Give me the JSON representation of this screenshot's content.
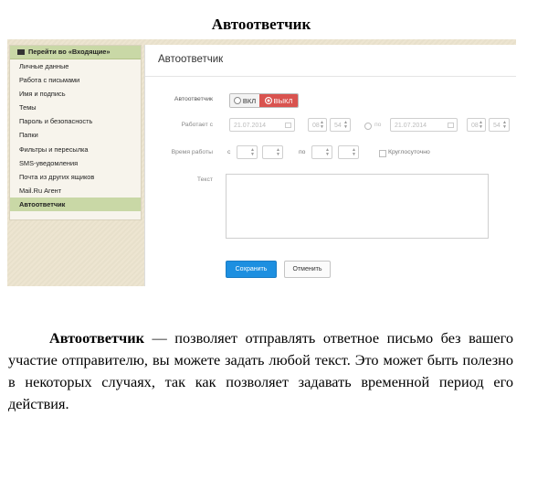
{
  "document": {
    "title": "Автоответчик",
    "paragraph": {
      "term": "Автоответчик",
      "text": " — позволяет отправлять ответное письмо без вашего участие отправителю, вы можете задать любой текст. Это может быть полезно в некоторых случаях, так как позволяет задавать временной период его действия."
    }
  },
  "screenshot": {
    "sidebar": {
      "header": "Перейти во «Входящие»",
      "items": [
        {
          "label": "Личные данные",
          "active": false
        },
        {
          "label": "Работа с письмами",
          "active": false
        },
        {
          "label": "Имя и подпись",
          "active": false
        },
        {
          "label": "Темы",
          "active": false
        },
        {
          "label": "Пароль и безопасность",
          "active": false
        },
        {
          "label": "Папки",
          "active": false
        },
        {
          "label": "Фильтры и пересылка",
          "active": false
        },
        {
          "label": "SMS-уведомления",
          "active": false
        },
        {
          "label": "Почта из других ящиков",
          "active": false
        },
        {
          "label": "Mail.Ru Агент",
          "active": false
        },
        {
          "label": "Автоответчик",
          "active": true
        }
      ]
    },
    "panel": {
      "title": "Автоответчик",
      "autoreply_label": "Автоответчик",
      "toggle_on": "ВКЛ",
      "toggle_off": "ВЫКЛ",
      "works_from_label": "Работает с",
      "date_from": "21.07.2014",
      "hour_from": "08",
      "minute_from": "54",
      "to_label": "по",
      "date_to": "21.07.2014",
      "hour_to": "08",
      "minute_to": "54",
      "work_time_label": "Время работы",
      "from_short": "с",
      "to_short": "по",
      "around_clock": "Круглосуточно",
      "text_label": "Текст",
      "save_label": "Сохранить",
      "cancel_label": "Отменить"
    },
    "colors": {
      "sidebar_active": "#c9d8a6",
      "toggle_off": "#d9534f",
      "save_button": "#1d8fe0"
    }
  }
}
